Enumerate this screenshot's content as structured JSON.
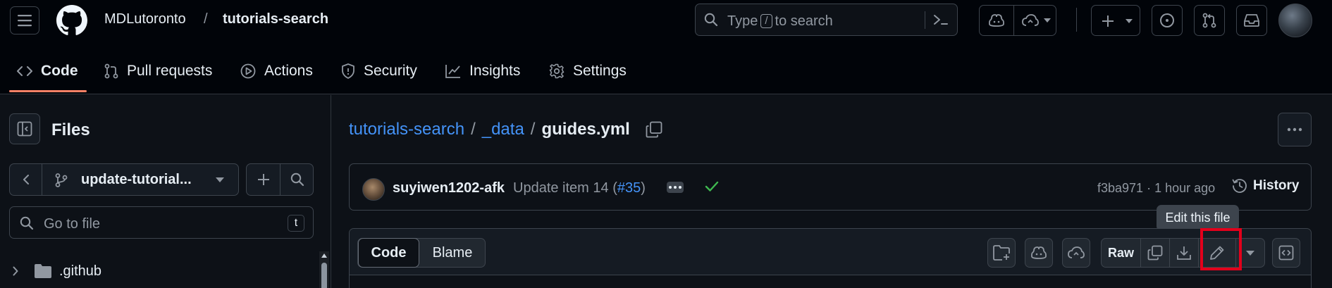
{
  "header": {
    "owner": "MDLutoronto",
    "separator": "/",
    "repo": "tutorials-search",
    "search": {
      "prefix": "Type",
      "key": "/",
      "suffix": "to search"
    }
  },
  "nav_tabs": [
    {
      "label": "Code",
      "icon": "code-icon",
      "active": true
    },
    {
      "label": "Pull requests",
      "icon": "git-pull-request-icon"
    },
    {
      "label": "Actions",
      "icon": "play-icon"
    },
    {
      "label": "Security",
      "icon": "shield-icon"
    },
    {
      "label": "Insights",
      "icon": "graph-icon"
    },
    {
      "label": "Settings",
      "icon": "gear-icon"
    }
  ],
  "sidebar": {
    "title": "Files",
    "branch": "update-tutorial...",
    "goto_placeholder": "Go to file",
    "goto_shortcut": "t",
    "tree": [
      {
        "name": ".github",
        "type": "folder",
        "expanded": false
      }
    ]
  },
  "breadcrumb": {
    "repo": "tutorials-search",
    "folder": "_data",
    "sep": "/",
    "file": "guides.yml"
  },
  "commit": {
    "author": "suyiwen1202-afk",
    "message_prefix": "Update item 14 (",
    "pr": "#35",
    "message_suffix": ")",
    "sha": "f3ba971",
    "time": "· 1 hour ago",
    "history_label": "History",
    "status": "success"
  },
  "file_toolbar": {
    "code_tab": "Code",
    "blame_tab": "Blame",
    "raw_label": "Raw",
    "tooltip": "Edit this file"
  },
  "colors": {
    "accent_link": "#4493f8",
    "active_tab_underline": "#f78166",
    "success": "#3fb950",
    "highlight_box": "#e3001b"
  }
}
